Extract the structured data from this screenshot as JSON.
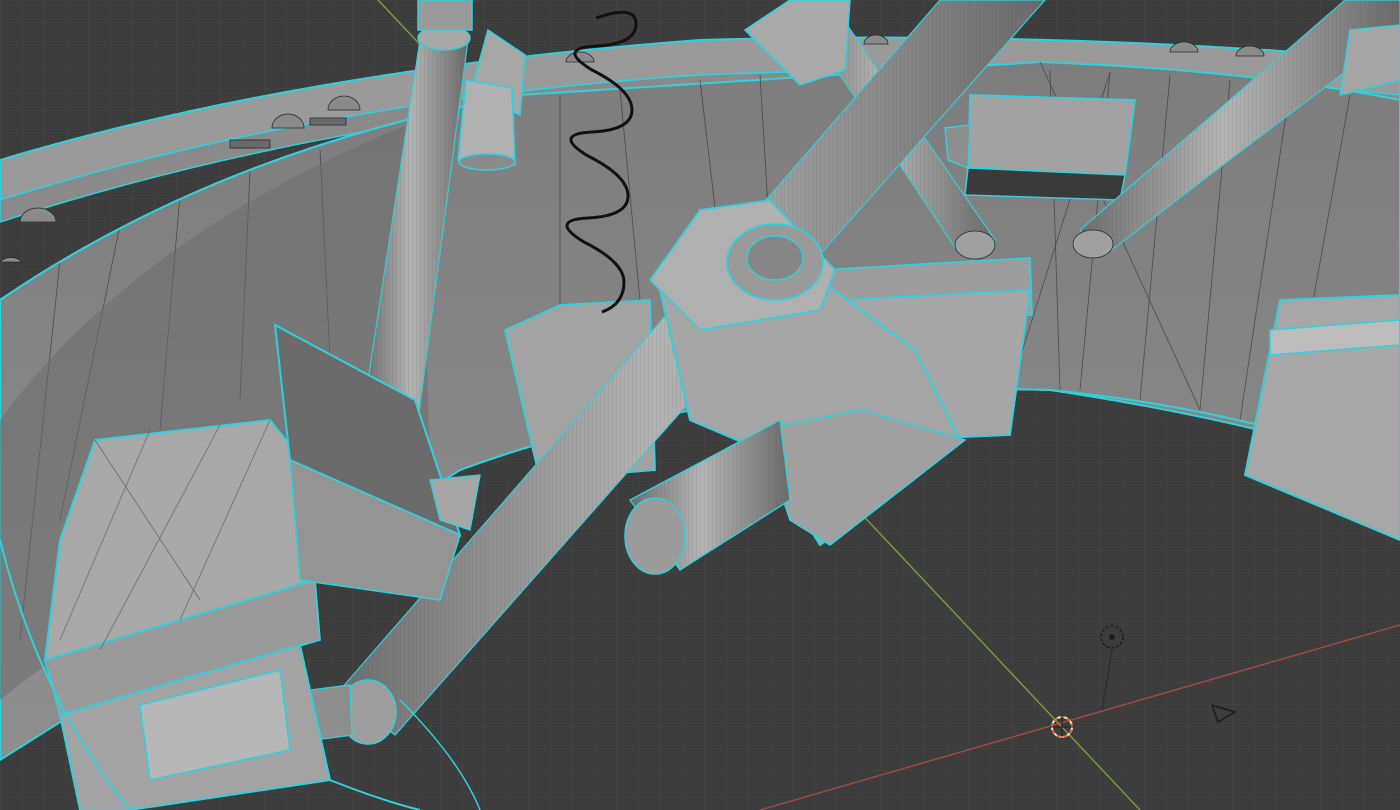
{
  "viewport": {
    "mode": "edit-mode-wireframe-overlay",
    "background_color": "#3d3d3d",
    "grid_color": "#4a4a4a",
    "x_axis_color": "#b34a4a",
    "y_axis_color": "#7f9a3a",
    "selection_color": "#30d0dc",
    "mesh_face_color": "#9c9c9c",
    "wire_color": "#2a2a2a",
    "cursor_color": "#e86a3a"
  },
  "objects": {
    "scene_model": "mechanical-ring-assembly",
    "spring": "spring",
    "light": "light-object",
    "camera": "camera-object",
    "cursor": "3d-cursor"
  }
}
